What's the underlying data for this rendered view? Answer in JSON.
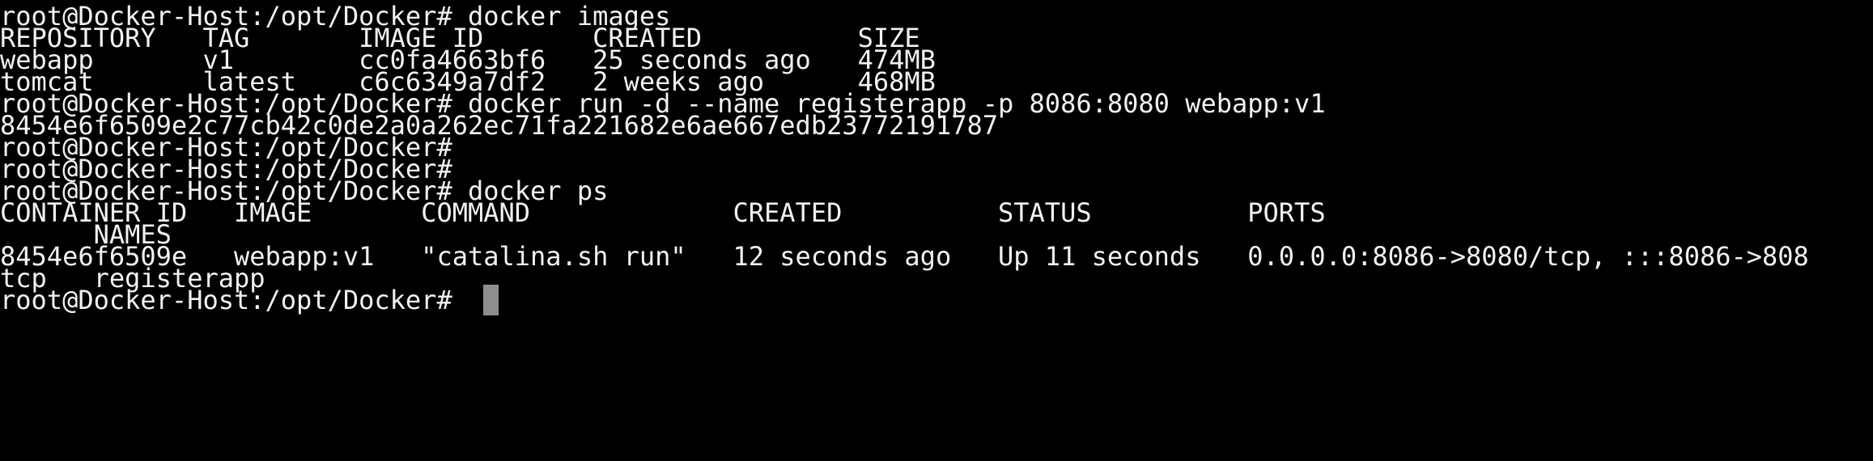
{
  "terminal": {
    "colors": {
      "background": "#000000",
      "foreground": "#f2f2f2",
      "cursor": "#8e8e8e"
    },
    "lines": [
      "root@Docker-Host:/opt/Docker# docker images",
      "REPOSITORY   TAG       IMAGE ID       CREATED          SIZE",
      "webapp       v1        cc0fa4663bf6   25 seconds ago   474MB",
      "tomcat       latest    c6c6349a7df2   2 weeks ago      468MB",
      "root@Docker-Host:/opt/Docker# docker run -d --name registerapp -p 8086:8080 webapp:v1",
      "8454e6f6509e2c77cb42c0de2a0a262ec71fa221682e6ae667edb23772191787",
      "root@Docker-Host:/opt/Docker#",
      "root@Docker-Host:/opt/Docker#",
      "root@Docker-Host:/opt/Docker# docker ps",
      "CONTAINER ID   IMAGE       COMMAND             CREATED          STATUS          PORTS",
      "      NAMES",
      "8454e6f6509e   webapp:v1   \"catalina.sh run\"   12 seconds ago   Up 11 seconds   0.0.0.0:8086->8080/tcp, :::8086->808",
      "tcp   registerapp",
      "root@Docker-Host:/opt/Docker# "
    ]
  }
}
